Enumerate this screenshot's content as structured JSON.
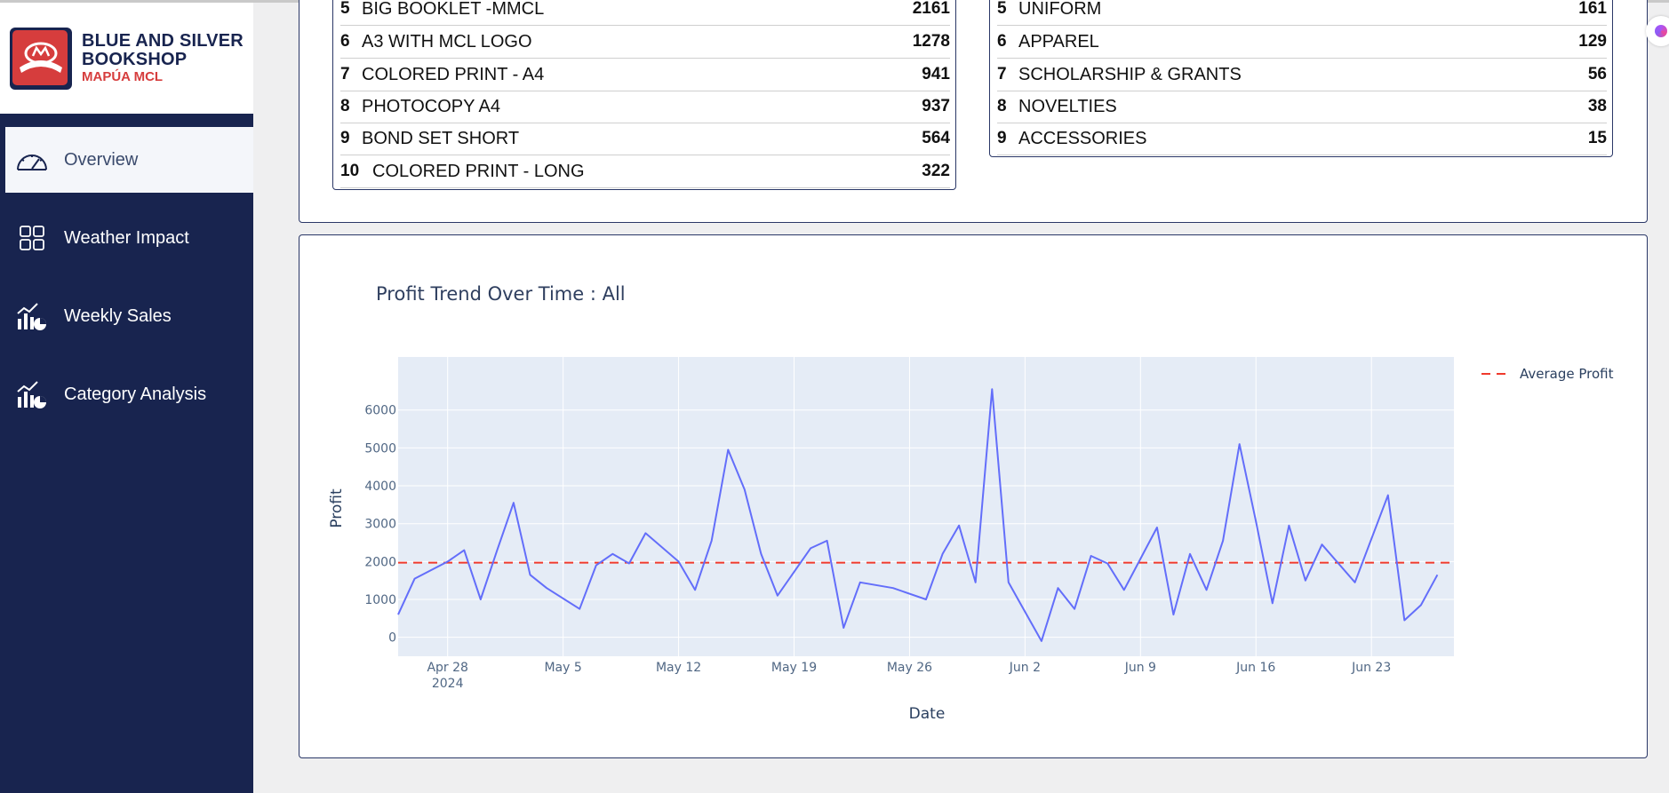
{
  "brand": {
    "line1": "BLUE AND SILVER",
    "line2": "BOOKSHOP",
    "sub": "MAPÚA MCL"
  },
  "nav": [
    {
      "label": "Overview",
      "icon": "gauge-icon",
      "active": true
    },
    {
      "label": "Weather Impact",
      "icon": "grid-icon",
      "active": false
    },
    {
      "label": "Weekly Sales",
      "icon": "chart-icon",
      "active": false
    },
    {
      "label": "Category Analysis",
      "icon": "chart-icon",
      "active": false
    }
  ],
  "products_table": {
    "rows": [
      {
        "rank": "5",
        "name": "BIG BOOKLET -MMCL",
        "value": "2161"
      },
      {
        "rank": "6",
        "name": "A3 WITH MCL LOGO",
        "value": "1278"
      },
      {
        "rank": "7",
        "name": "COLORED PRINT - A4",
        "value": "941"
      },
      {
        "rank": "8",
        "name": "PHOTOCOPY A4",
        "value": "937"
      },
      {
        "rank": "9",
        "name": "BOND SET SHORT",
        "value": "564"
      },
      {
        "rank": "10",
        "name": "COLORED PRINT - LONG",
        "value": "322"
      }
    ]
  },
  "categories_table": {
    "rows": [
      {
        "rank": "5",
        "name": "UNIFORM",
        "value": "161"
      },
      {
        "rank": "6",
        "name": "APPAREL",
        "value": "129"
      },
      {
        "rank": "7",
        "name": "SCHOLARSHIP & GRANTS",
        "value": "56"
      },
      {
        "rank": "8",
        "name": "NOVELTIES",
        "value": "38"
      },
      {
        "rank": "9",
        "name": "ACCESSORIES",
        "value": "15"
      }
    ]
  },
  "colors": {
    "sidebar": "#18244f",
    "line": "#636efa",
    "average": "#ef3a2c",
    "plot_bg": "#e5ecf6",
    "accent_red": "#d63d3d"
  },
  "chart_data": {
    "type": "line",
    "title": "Profit Trend Over Time : All",
    "xlabel": "Date",
    "ylabel": "Profit",
    "ylim": [
      -500,
      7400
    ],
    "xlim": [
      "2024-04-25",
      "2024-06-28"
    ],
    "x_ticks": [
      {
        "date": "2024-04-28",
        "label": "Apr 28",
        "sub": "2024"
      },
      {
        "date": "2024-05-05",
        "label": "May 5"
      },
      {
        "date": "2024-05-12",
        "label": "May 12"
      },
      {
        "date": "2024-05-19",
        "label": "May 19"
      },
      {
        "date": "2024-05-26",
        "label": "May 26"
      },
      {
        "date": "2024-06-02",
        "label": "Jun 2"
      },
      {
        "date": "2024-06-09",
        "label": "Jun 9"
      },
      {
        "date": "2024-06-16",
        "label": "Jun 16"
      },
      {
        "date": "2024-06-23",
        "label": "Jun 23"
      }
    ],
    "y_ticks": [
      0,
      1000,
      2000,
      3000,
      4000,
      5000,
      6000
    ],
    "grid": true,
    "legend": "top-right",
    "series": [
      {
        "points": [
          [
            "2024-04-25",
            600
          ],
          [
            "2024-04-26",
            1550
          ],
          [
            "2024-04-28",
            2000
          ],
          [
            "2024-04-29",
            2300
          ],
          [
            "2024-04-30",
            1000
          ],
          [
            "2024-05-01",
            2300
          ],
          [
            "2024-05-02",
            3550
          ],
          [
            "2024-05-03",
            1650
          ],
          [
            "2024-05-04",
            1300
          ],
          [
            "2024-05-06",
            750
          ],
          [
            "2024-05-07",
            1900
          ],
          [
            "2024-05-08",
            2200
          ],
          [
            "2024-05-09",
            1950
          ],
          [
            "2024-05-10",
            2750
          ],
          [
            "2024-05-12",
            2000
          ],
          [
            "2024-05-13",
            1250
          ],
          [
            "2024-05-14",
            2550
          ],
          [
            "2024-05-15",
            4950
          ],
          [
            "2024-05-16",
            3900
          ],
          [
            "2024-05-17",
            2200
          ],
          [
            "2024-05-18",
            1100
          ],
          [
            "2024-05-20",
            2350
          ],
          [
            "2024-05-21",
            2550
          ],
          [
            "2024-05-22",
            250
          ],
          [
            "2024-05-23",
            1450
          ],
          [
            "2024-05-25",
            1300
          ],
          [
            "2024-05-27",
            1000
          ],
          [
            "2024-05-28",
            2200
          ],
          [
            "2024-05-29",
            2950
          ],
          [
            "2024-05-30",
            1450
          ],
          [
            "2024-05-31",
            6550
          ],
          [
            "2024-06-01",
            1450
          ],
          [
            "2024-06-03",
            -100
          ],
          [
            "2024-06-04",
            1300
          ],
          [
            "2024-06-05",
            750
          ],
          [
            "2024-06-06",
            2150
          ],
          [
            "2024-06-07",
            1950
          ],
          [
            "2024-06-08",
            1250
          ],
          [
            "2024-06-10",
            2900
          ],
          [
            "2024-06-11",
            600
          ],
          [
            "2024-06-12",
            2200
          ],
          [
            "2024-06-13",
            1250
          ],
          [
            "2024-06-14",
            2550
          ],
          [
            "2024-06-15",
            5100
          ],
          [
            "2024-06-16",
            3050
          ],
          [
            "2024-06-17",
            900
          ],
          [
            "2024-06-18",
            2950
          ],
          [
            "2024-06-19",
            1500
          ],
          [
            "2024-06-20",
            2450
          ],
          [
            "2024-06-22",
            1450
          ],
          [
            "2024-06-24",
            3750
          ],
          [
            "2024-06-25",
            450
          ],
          [
            "2024-06-26",
            850
          ],
          [
            "2024-06-27",
            1650
          ]
        ]
      }
    ],
    "average": {
      "name": "Average Profit",
      "value": 1970
    }
  }
}
